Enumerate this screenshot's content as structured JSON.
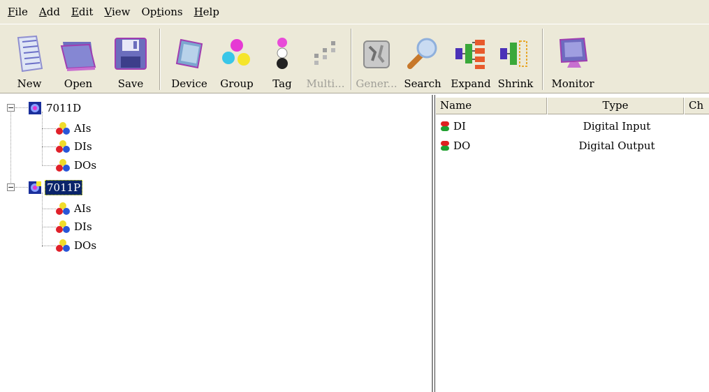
{
  "menu": [
    {
      "pre": "",
      "u": "F",
      "post": "ile"
    },
    {
      "pre": "",
      "u": "A",
      "post": "dd"
    },
    {
      "pre": "",
      "u": "E",
      "post": "dit"
    },
    {
      "pre": "",
      "u": "V",
      "post": "iew"
    },
    {
      "pre": "Op",
      "u": "t",
      "post": "ions"
    },
    {
      "pre": "",
      "u": "H",
      "post": "elp"
    }
  ],
  "toolbar": {
    "new": "New",
    "open": "Open",
    "save": "Save",
    "device": "Device",
    "group": "Group",
    "tag": "Tag",
    "multi": "Multi...",
    "gener": "Gener...",
    "search": "Search",
    "expand": "Expand",
    "shrink": "Shrink",
    "monitor": "Monitor"
  },
  "tree": {
    "device1": {
      "label": "7011D",
      "children": [
        "AIs",
        "DIs",
        "DOs"
      ]
    },
    "device2": {
      "label": "7011P",
      "children": [
        "AIs",
        "DIs",
        "DOs"
      ]
    }
  },
  "list": {
    "columns": [
      "Name",
      "Type",
      "Ch"
    ],
    "rows": [
      {
        "name": "DI",
        "type": "Digital Input"
      },
      {
        "name": "DO",
        "type": "Digital Output"
      }
    ]
  },
  "colors": {
    "chrome": "#ece9d8",
    "selection": "#0a246a"
  }
}
